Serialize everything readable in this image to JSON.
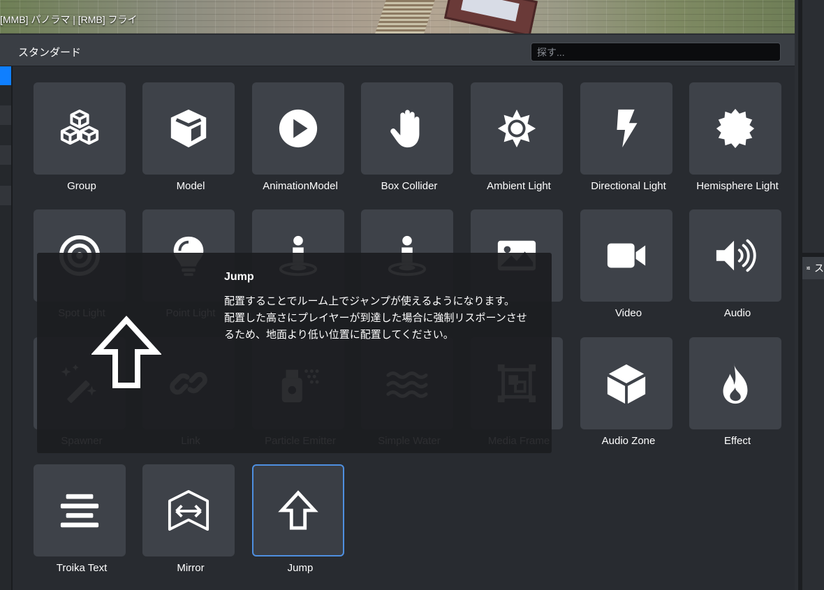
{
  "viewport": {
    "hint": "[MMB] パノラマ | [RMB] フライ"
  },
  "panel": {
    "title": "スタンダード",
    "search_placeholder": "探す..."
  },
  "right_panel": {
    "tab_label": "ス"
  },
  "items": [
    {
      "label": "Group",
      "icon": "cubes-icon"
    },
    {
      "label": "Model",
      "icon": "cube-icon"
    },
    {
      "label": "AnimationModel",
      "icon": "play-circle-icon"
    },
    {
      "label": "Box Collider",
      "icon": "hand-icon"
    },
    {
      "label": "Ambient Light",
      "icon": "sun-icon"
    },
    {
      "label": "Directional Light",
      "icon": "bolt-icon"
    },
    {
      "label": "Hemisphere Light",
      "icon": "certificate-icon"
    },
    {
      "label": "Spot Light",
      "icon": "bullseye-icon"
    },
    {
      "label": "Point Light",
      "icon": "lightbulb-icon"
    },
    {
      "label": "",
      "icon": "person-spawn-icon"
    },
    {
      "label": "",
      "icon": "person-spawn-icon"
    },
    {
      "label": "",
      "icon": "image-icon"
    },
    {
      "label": "Video",
      "icon": "video-icon"
    },
    {
      "label": "Audio",
      "icon": "volume-icon"
    },
    {
      "label": "Spawner",
      "icon": "magic-wand-icon"
    },
    {
      "label": "Link",
      "icon": "link-icon"
    },
    {
      "label": "Particle Emitter",
      "icon": "spray-can-icon"
    },
    {
      "label": "Simple Water",
      "icon": "water-icon"
    },
    {
      "label": "Media Frame",
      "icon": "media-frame-icon"
    },
    {
      "label": "Audio Zone",
      "icon": "cube-3d-icon"
    },
    {
      "label": "Effect",
      "icon": "fire-icon"
    },
    {
      "label": "Troika Text",
      "icon": "align-center-icon"
    },
    {
      "label": "Mirror",
      "icon": "mirror-icon"
    },
    {
      "label": "Jump",
      "icon": "arrow-up-icon"
    }
  ],
  "selected_item": "Jump",
  "tooltip": {
    "title": "Jump",
    "lines": [
      "配置することでルーム上でジャンプが使えるようになります。",
      "配置した高さにプレイヤーが到達した場合に強制リスポーンさせ",
      "るため、地面より低い位置に配置してください。"
    ],
    "icon": "arrow-up-icon"
  },
  "colors": {
    "accent": "#0f7fff",
    "selected_border": "#4e8fe0",
    "tile": "#3e4249",
    "panel": "#282b30"
  }
}
